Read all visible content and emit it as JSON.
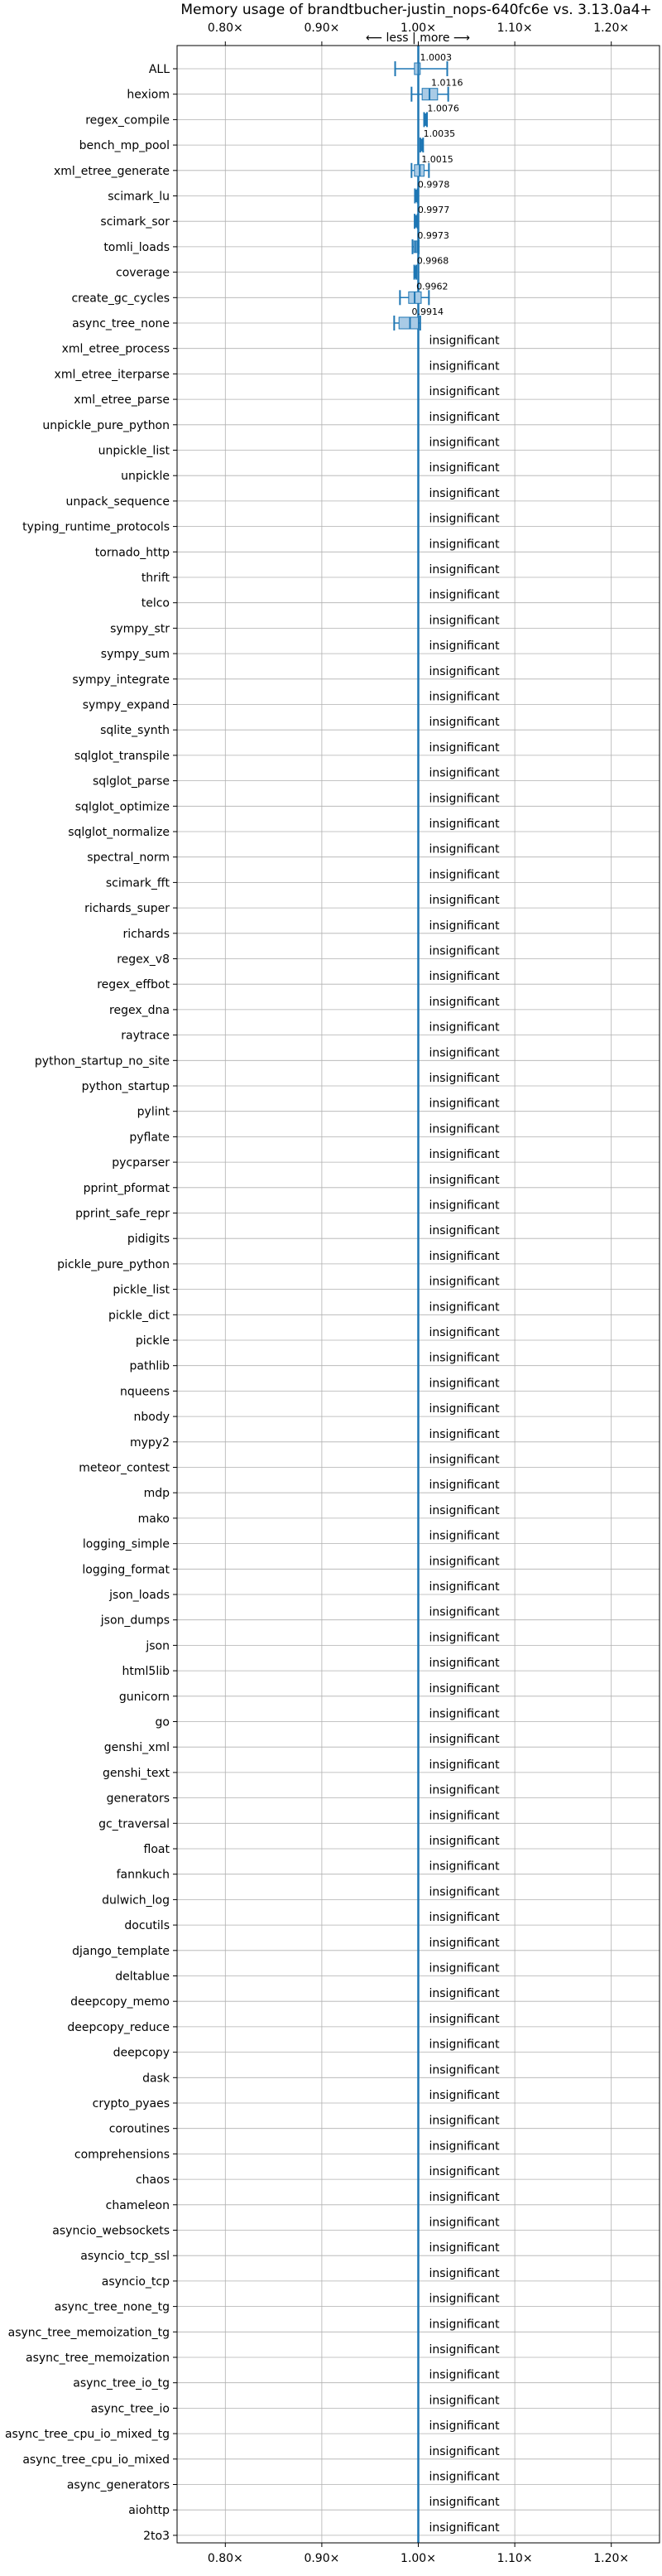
{
  "chart_data": {
    "type": "box",
    "title": "Memory usage of brandtbucher-justin_nops-640fc6e vs. 3.13.0a4+",
    "direction_annotation": "⟵ less | more ⟶",
    "xlim": [
      0.75,
      1.25
    ],
    "x_ticks": [
      0.8,
      0.9,
      1.0,
      1.1,
      1.2
    ],
    "x_tick_labels": [
      "0.80×",
      "0.90×",
      "1.00×",
      "1.10×",
      "1.20×"
    ],
    "reference_line": 1.0,
    "grid": true,
    "insignificant_label": "insignificant",
    "benchmarks": [
      {
        "name": "ALL",
        "label": "1.0003",
        "min": 0.976,
        "q1": 0.996,
        "median": 1.0,
        "q3": 1.002,
        "max": 1.03
      },
      {
        "name": "hexiom",
        "label": "1.0116",
        "min": 0.993,
        "q1": 1.004,
        "median": 1.0116,
        "q3": 1.02,
        "max": 1.031
      },
      {
        "name": "regex_compile",
        "label": "1.0076",
        "min": 1.006,
        "q1": 1.0068,
        "median": 1.0076,
        "q3": 1.0082,
        "max": 1.009
      },
      {
        "name": "bench_mp_pool",
        "label": "1.0035",
        "min": 1.002,
        "q1": 1.003,
        "median": 1.0035,
        "q3": 1.004,
        "max": 1.005
      },
      {
        "name": "xml_etree_generate",
        "label": "1.0015",
        "min": 0.993,
        "q1": 0.996,
        "median": 1.0015,
        "q3": 1.006,
        "max": 1.011
      },
      {
        "name": "scimark_lu",
        "label": "0.9978",
        "min": 0.9965,
        "q1": 0.9972,
        "median": 0.9978,
        "q3": 0.9984,
        "max": 0.9992
      },
      {
        "name": "scimark_sor",
        "label": "0.9977",
        "min": 0.9962,
        "q1": 0.997,
        "median": 0.9977,
        "q3": 0.9983,
        "max": 0.9992
      },
      {
        "name": "tomli_loads",
        "label": "0.9973",
        "min": 0.994,
        "q1": 0.9955,
        "median": 0.9973,
        "q3": 0.999,
        "max": 1.0005
      },
      {
        "name": "coverage",
        "label": "0.9968",
        "min": 0.9958,
        "q1": 0.9963,
        "median": 0.9968,
        "q3": 0.9973,
        "max": 0.998
      },
      {
        "name": "create_gc_cycles",
        "label": "0.9962",
        "min": 0.981,
        "q1": 0.99,
        "median": 0.9962,
        "q3": 1.003,
        "max": 1.011
      },
      {
        "name": "async_tree_none",
        "label": "0.9914",
        "min": 0.975,
        "q1": 0.98,
        "median": 0.9914,
        "q3": 1.0,
        "max": 1.002
      },
      {
        "name": "xml_etree_process",
        "insignificant": true
      },
      {
        "name": "xml_etree_iterparse",
        "insignificant": true
      },
      {
        "name": "xml_etree_parse",
        "insignificant": true
      },
      {
        "name": "unpickle_pure_python",
        "insignificant": true
      },
      {
        "name": "unpickle_list",
        "insignificant": true
      },
      {
        "name": "unpickle",
        "insignificant": true
      },
      {
        "name": "unpack_sequence",
        "insignificant": true
      },
      {
        "name": "typing_runtime_protocols",
        "insignificant": true
      },
      {
        "name": "tornado_http",
        "insignificant": true
      },
      {
        "name": "thrift",
        "insignificant": true
      },
      {
        "name": "telco",
        "insignificant": true
      },
      {
        "name": "sympy_str",
        "insignificant": true
      },
      {
        "name": "sympy_sum",
        "insignificant": true
      },
      {
        "name": "sympy_integrate",
        "insignificant": true
      },
      {
        "name": "sympy_expand",
        "insignificant": true
      },
      {
        "name": "sqlite_synth",
        "insignificant": true
      },
      {
        "name": "sqlglot_transpile",
        "insignificant": true
      },
      {
        "name": "sqlglot_parse",
        "insignificant": true
      },
      {
        "name": "sqlglot_optimize",
        "insignificant": true
      },
      {
        "name": "sqlglot_normalize",
        "insignificant": true
      },
      {
        "name": "spectral_norm",
        "insignificant": true
      },
      {
        "name": "scimark_fft",
        "insignificant": true
      },
      {
        "name": "richards_super",
        "insignificant": true
      },
      {
        "name": "richards",
        "insignificant": true
      },
      {
        "name": "regex_v8",
        "insignificant": true
      },
      {
        "name": "regex_effbot",
        "insignificant": true
      },
      {
        "name": "regex_dna",
        "insignificant": true
      },
      {
        "name": "raytrace",
        "insignificant": true
      },
      {
        "name": "python_startup_no_site",
        "insignificant": true
      },
      {
        "name": "python_startup",
        "insignificant": true
      },
      {
        "name": "pylint",
        "insignificant": true
      },
      {
        "name": "pyflate",
        "insignificant": true
      },
      {
        "name": "pycparser",
        "insignificant": true
      },
      {
        "name": "pprint_pformat",
        "insignificant": true
      },
      {
        "name": "pprint_safe_repr",
        "insignificant": true
      },
      {
        "name": "pidigits",
        "insignificant": true
      },
      {
        "name": "pickle_pure_python",
        "insignificant": true
      },
      {
        "name": "pickle_list",
        "insignificant": true
      },
      {
        "name": "pickle_dict",
        "insignificant": true
      },
      {
        "name": "pickle",
        "insignificant": true
      },
      {
        "name": "pathlib",
        "insignificant": true
      },
      {
        "name": "nqueens",
        "insignificant": true
      },
      {
        "name": "nbody",
        "insignificant": true
      },
      {
        "name": "mypy2",
        "insignificant": true
      },
      {
        "name": "meteor_contest",
        "insignificant": true
      },
      {
        "name": "mdp",
        "insignificant": true
      },
      {
        "name": "mako",
        "insignificant": true
      },
      {
        "name": "logging_simple",
        "insignificant": true
      },
      {
        "name": "logging_format",
        "insignificant": true
      },
      {
        "name": "json_loads",
        "insignificant": true
      },
      {
        "name": "json_dumps",
        "insignificant": true
      },
      {
        "name": "json",
        "insignificant": true
      },
      {
        "name": "html5lib",
        "insignificant": true
      },
      {
        "name": "gunicorn",
        "insignificant": true
      },
      {
        "name": "go",
        "insignificant": true
      },
      {
        "name": "genshi_xml",
        "insignificant": true
      },
      {
        "name": "genshi_text",
        "insignificant": true
      },
      {
        "name": "generators",
        "insignificant": true
      },
      {
        "name": "gc_traversal",
        "insignificant": true
      },
      {
        "name": "float",
        "insignificant": true
      },
      {
        "name": "fannkuch",
        "insignificant": true
      },
      {
        "name": "dulwich_log",
        "insignificant": true
      },
      {
        "name": "docutils",
        "insignificant": true
      },
      {
        "name": "django_template",
        "insignificant": true
      },
      {
        "name": "deltablue",
        "insignificant": true
      },
      {
        "name": "deepcopy_memo",
        "insignificant": true
      },
      {
        "name": "deepcopy_reduce",
        "insignificant": true
      },
      {
        "name": "deepcopy",
        "insignificant": true
      },
      {
        "name": "dask",
        "insignificant": true
      },
      {
        "name": "crypto_pyaes",
        "insignificant": true
      },
      {
        "name": "coroutines",
        "insignificant": true
      },
      {
        "name": "comprehensions",
        "insignificant": true
      },
      {
        "name": "chaos",
        "insignificant": true
      },
      {
        "name": "chameleon",
        "insignificant": true
      },
      {
        "name": "asyncio_websockets",
        "insignificant": true
      },
      {
        "name": "asyncio_tcp_ssl",
        "insignificant": true
      },
      {
        "name": "asyncio_tcp",
        "insignificant": true
      },
      {
        "name": "async_tree_none_tg",
        "insignificant": true
      },
      {
        "name": "async_tree_memoization_tg",
        "insignificant": true
      },
      {
        "name": "async_tree_memoization",
        "insignificant": true
      },
      {
        "name": "async_tree_io_tg",
        "insignificant": true
      },
      {
        "name": "async_tree_io",
        "insignificant": true
      },
      {
        "name": "async_tree_cpu_io_mixed_tg",
        "insignificant": true
      },
      {
        "name": "async_tree_cpu_io_mixed",
        "insignificant": true
      },
      {
        "name": "async_generators",
        "insignificant": true
      },
      {
        "name": "aiohttp",
        "insignificant": true
      },
      {
        "name": "2to3",
        "insignificant": true
      }
    ]
  },
  "colors": {
    "box_fill": "#a9cbe6",
    "box_edge": "#1f77b4",
    "reference_line": "#1f77b4",
    "grid": "#b0b0b0",
    "text": "#000000"
  }
}
